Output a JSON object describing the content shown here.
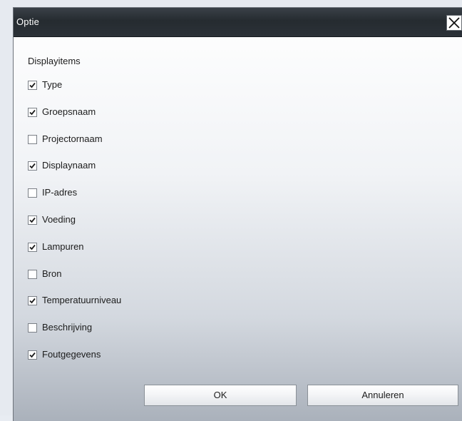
{
  "dialog": {
    "title": "Optie",
    "close_icon": "close-x-icon",
    "group_label": "Displayitems",
    "options": [
      {
        "label": "Type",
        "checked": true
      },
      {
        "label": "Groepsnaam",
        "checked": true
      },
      {
        "label": "Projectornaam",
        "checked": false
      },
      {
        "label": "Displaynaam",
        "checked": true
      },
      {
        "label": "IP-adres",
        "checked": false
      },
      {
        "label": "Voeding",
        "checked": true
      },
      {
        "label": "Lampuren",
        "checked": true
      },
      {
        "label": "Bron",
        "checked": false
      },
      {
        "label": "Temperatuurniveau",
        "checked": true
      },
      {
        "label": "Beschrijving",
        "checked": false
      },
      {
        "label": "Foutgegevens",
        "checked": true
      }
    ],
    "ok_label": "OK",
    "cancel_label": "Annuleren"
  },
  "colors": {
    "titlebar": "#2c3238",
    "title_text": "#ffffff",
    "check_mark": "#1c1c1c"
  }
}
